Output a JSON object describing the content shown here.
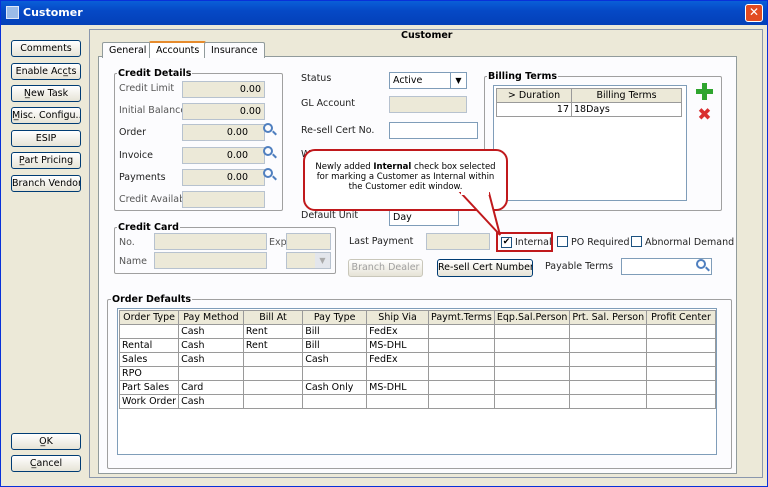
{
  "window": {
    "title": "Customer",
    "close_glyph": "✕"
  },
  "sidebar": {
    "buttons": [
      "Comments",
      "Enable Acc̲ts",
      "N̲ew Task",
      "M̲isc. Configu...",
      "ESIP",
      "P̲art Pricing",
      "Branch Vendor"
    ],
    "ok": "O̲K",
    "cancel": "C̲ancel"
  },
  "header": {
    "title": "Customer"
  },
  "tabs": [
    "General",
    "Accounts",
    "Insurance"
  ],
  "selected_tab": "Accounts",
  "credit_details": {
    "title": "Credit Details",
    "rows": [
      {
        "label": "Credit Limit",
        "value": "0.00"
      },
      {
        "label": "Initial Balance",
        "value": "0.00"
      },
      {
        "label": "Order",
        "value": "0.00"
      },
      {
        "label": "Invoice",
        "value": "0.00"
      },
      {
        "label": "Payments",
        "value": "0.00"
      },
      {
        "label": "Credit Available",
        "value": ""
      }
    ]
  },
  "middle": {
    "status_label": "Status",
    "status_value": "Active",
    "gl_label": "GL Account",
    "resell_label": "Re-sell Cert No.",
    "wo_label": "Wo",
    "default_unit_label": "Default Unit",
    "default_unit_value": "Day",
    "last_payment_label": "Last Payment",
    "branch_dealer": "Branch Dealer",
    "resell_cert_numbers": "Re-sell Cert Numbers",
    "payable_terms_label": "Payable Terms"
  },
  "billing_terms": {
    "title": "Billing Terms",
    "headers": [
      "> Duration",
      "Billing Terms"
    ],
    "rows": [
      {
        "duration": "17",
        "terms": "18Days"
      }
    ]
  },
  "credit_card": {
    "title": "Credit Card",
    "no_label": "No.",
    "exp_label": "Exp",
    "name_label": "Name"
  },
  "checkboxes": {
    "internal": {
      "label": "Internal",
      "checked": true
    },
    "po_required": {
      "label": "PO Required",
      "checked": false
    },
    "abnormal_demand": {
      "label": "Abnormal Demand",
      "checked": false
    }
  },
  "callout": {
    "before": "Newly added ",
    "bold": "Internal",
    "after": " check box selected for marking a Customer as Internal within the Customer edit window."
  },
  "order_defaults": {
    "title": "Order Defaults",
    "headers": [
      "Order Type",
      "Pay Method",
      "Bill At",
      "Pay Type",
      "Ship Via",
      "Paymt.Terms",
      "Eqp.Sal.Person",
      "Prt. Sal. Person",
      "Profit Center"
    ],
    "rows": [
      [
        "",
        "Cash",
        "Rent",
        "Bill",
        "FedEx",
        "",
        "",
        "",
        ""
      ],
      [
        "Rental",
        "Cash",
        "Rent",
        "Bill",
        "MS-DHL",
        "",
        "",
        "",
        ""
      ],
      [
        "Sales",
        "Cash",
        "",
        "Cash",
        "FedEx",
        "",
        "",
        "",
        ""
      ],
      [
        "RPO",
        "",
        "",
        "",
        "",
        "",
        "",
        "",
        ""
      ],
      [
        "Part Sales",
        "Card",
        "",
        "Cash Only",
        "MS-DHL",
        "",
        "",
        "",
        ""
      ],
      [
        "Work Order",
        "Cash",
        "",
        "",
        "",
        "",
        "",
        "",
        ""
      ]
    ]
  },
  "colors": {
    "titlebar": "#0549c6",
    "highlight": "#c0191c",
    "add_icon": "#2fa52f",
    "delete_icon": "#d93030"
  }
}
